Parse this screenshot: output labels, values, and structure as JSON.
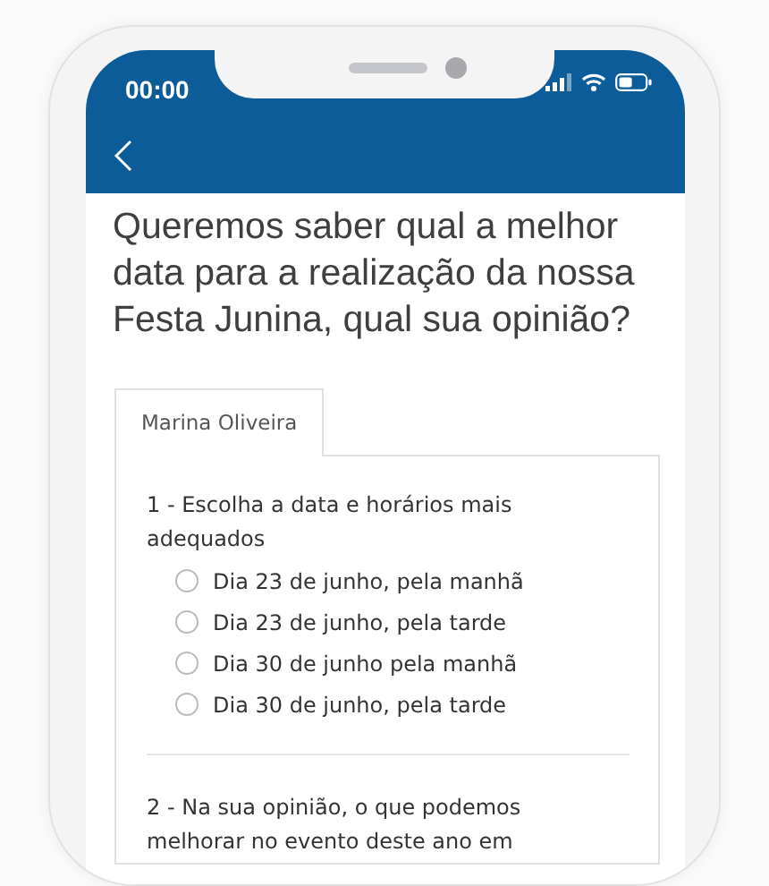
{
  "status_bar": {
    "time": "00:00"
  },
  "title": "Queremos saber qual a melhor data para a realização da nossa Festa Junina, qual sua opinião?",
  "tabs": [
    {
      "label": "Marina Oliveira",
      "selected": true
    }
  ],
  "questions": [
    {
      "text": "1 - Escolha a data e horários mais adequados",
      "options": [
        {
          "label": "Dia 23 de junho, pela manhã",
          "selected": false
        },
        {
          "label": "Dia 23 de junho, pela tarde",
          "selected": false
        },
        {
          "label": "Dia 30 de junho pela manhã",
          "selected": false
        },
        {
          "label": "Dia 30 de junho, pela tarde",
          "selected": false
        }
      ]
    },
    {
      "text": "2 - Na sua opinião, o que podemos melhorar no evento deste ano em"
    }
  ]
}
